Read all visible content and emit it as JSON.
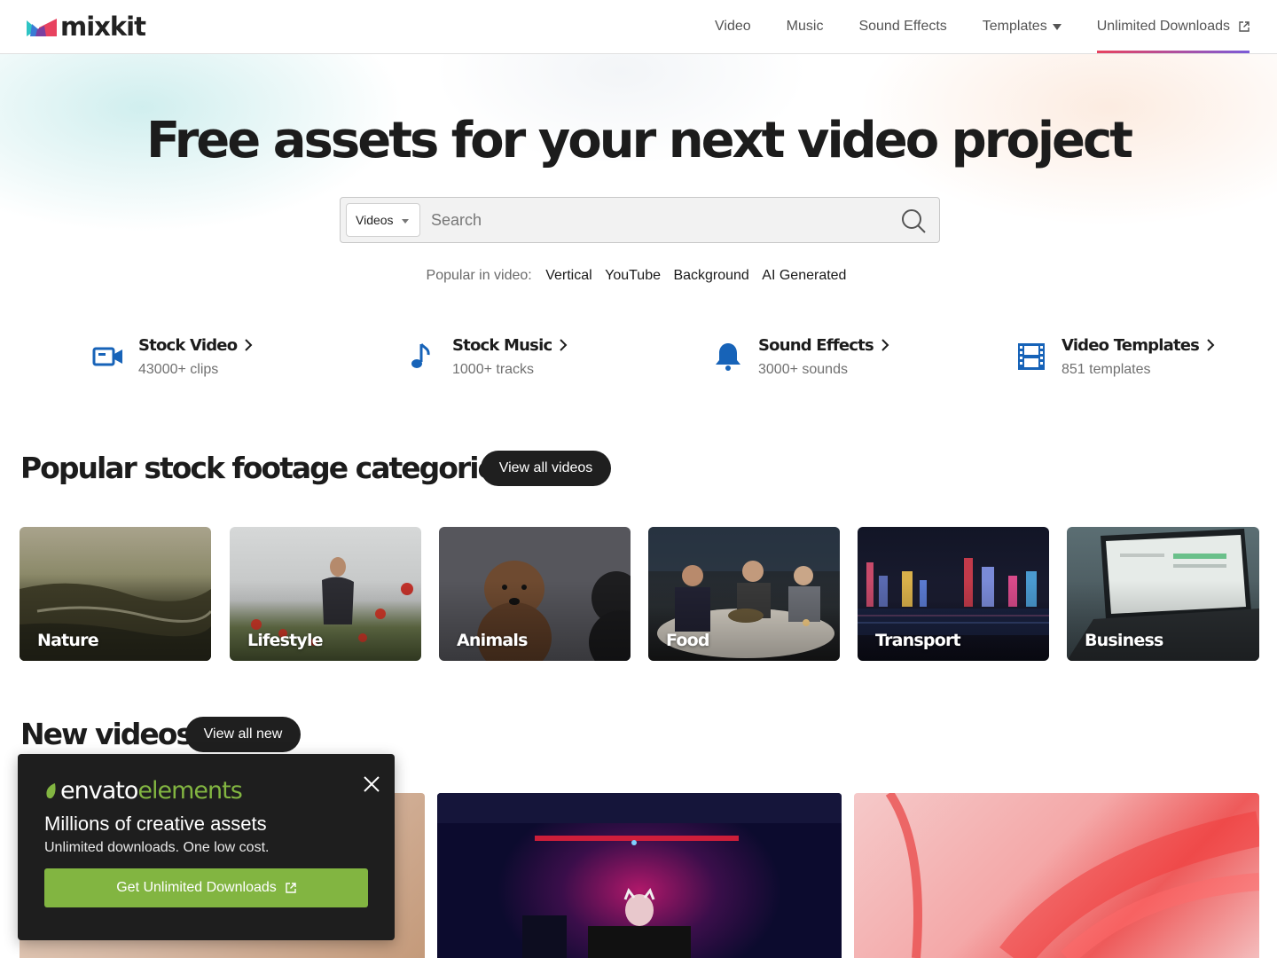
{
  "header": {
    "logo_text": "mixkit",
    "nav": [
      {
        "label": "Video"
      },
      {
        "label": "Music"
      },
      {
        "label": "Sound Effects"
      },
      {
        "label": "Templates"
      },
      {
        "label": "Unlimited Downloads"
      }
    ]
  },
  "hero": {
    "title": "Free assets for your next video project",
    "search": {
      "category": "Videos",
      "placeholder": "Search"
    },
    "popular_label": "Popular in video:",
    "popular_links": [
      "Vertical",
      "YouTube",
      "Background",
      "AI Generated"
    ]
  },
  "assets": [
    {
      "title": "Stock Video",
      "sub": "43000+ clips",
      "icon": "video-camera-icon"
    },
    {
      "title": "Stock Music",
      "sub": "1000+ tracks",
      "icon": "music-note-icon"
    },
    {
      "title": "Sound Effects",
      "sub": "3000+ sounds",
      "icon": "bell-icon"
    },
    {
      "title": "Video Templates",
      "sub": "851 templates",
      "icon": "film-strip-icon"
    }
  ],
  "categories_section": {
    "title": "Popular stock footage categories",
    "button": "View all videos",
    "tiles": [
      "Nature",
      "Lifestyle",
      "Animals",
      "Food",
      "Transport",
      "Business"
    ]
  },
  "new_section": {
    "title": "New videos",
    "button": "View all new"
  },
  "popup": {
    "brand_1": "envato",
    "brand_2": "elements",
    "title": "Millions of creative assets",
    "subtitle": "Unlimited downloads. One low cost.",
    "button": "Get Unlimited Downloads"
  },
  "colors": {
    "accent_gradient_start": "#e8425f",
    "accent_gradient_end": "#7b5bd8",
    "asset_icon_blue": "#1763b8",
    "envato_green": "#82b541",
    "pill_bg": "#1f1f1f"
  }
}
